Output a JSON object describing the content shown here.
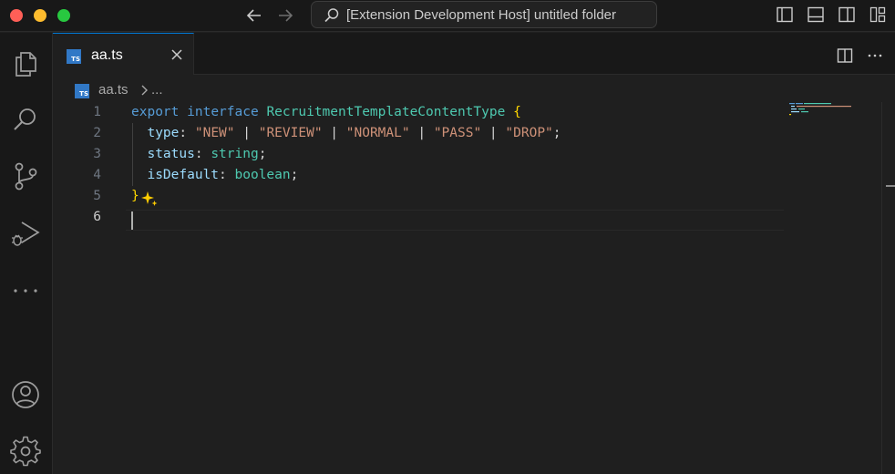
{
  "window": {
    "title": "[Extension Development Host] untitled folder"
  },
  "tabs": [
    {
      "label": "aa.ts",
      "icon": "typescript-file-icon",
      "badge": "TS",
      "active": true
    }
  ],
  "breadcrumb": {
    "file": "aa.ts",
    "more": "..."
  },
  "editor": {
    "language": "typescript",
    "active_line": 6,
    "lines": [
      {
        "number": "1",
        "tokens": [
          [
            "kw",
            "export"
          ],
          [
            "pu",
            " "
          ],
          [
            "kw2",
            "interface"
          ],
          [
            "pu",
            " "
          ],
          [
            "ty",
            "RecruitmentTemplateContentType"
          ],
          [
            "pu",
            " "
          ],
          [
            "br",
            "{"
          ]
        ]
      },
      {
        "number": "2",
        "tokens": [
          [
            "pu",
            "  "
          ],
          [
            "pr",
            "type"
          ],
          [
            "pu",
            ": "
          ],
          [
            "st",
            "\"NEW\""
          ],
          [
            "pu",
            " | "
          ],
          [
            "st",
            "\"REVIEW\""
          ],
          [
            "pu",
            " | "
          ],
          [
            "st",
            "\"NORMAL\""
          ],
          [
            "pu",
            " | "
          ],
          [
            "st",
            "\"PASS\""
          ],
          [
            "pu",
            " | "
          ],
          [
            "st",
            "\"DROP\""
          ],
          [
            "pu",
            ";"
          ]
        ]
      },
      {
        "number": "3",
        "tokens": [
          [
            "pu",
            "  "
          ],
          [
            "pr",
            "status"
          ],
          [
            "pu",
            ": "
          ],
          [
            "ty",
            "string"
          ],
          [
            "pu",
            ";"
          ]
        ]
      },
      {
        "number": "4",
        "tokens": [
          [
            "pu",
            "  "
          ],
          [
            "pr",
            "isDefault"
          ],
          [
            "pu",
            ": "
          ],
          [
            "ty",
            "boolean"
          ],
          [
            "pu",
            ";"
          ]
        ]
      },
      {
        "number": "5",
        "tokens": [
          [
            "br",
            "}"
          ]
        ]
      },
      {
        "number": "6",
        "tokens": []
      }
    ]
  },
  "colors": {
    "accent": "#0078d4",
    "typescript_badge": "#3178c6",
    "sparkle": "#ffcc00"
  }
}
